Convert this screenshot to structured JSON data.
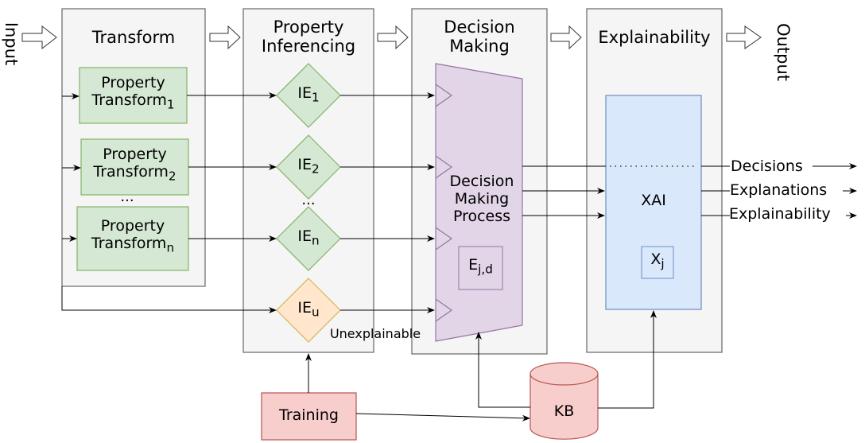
{
  "io": {
    "input_label": "Input",
    "output_label": "Output"
  },
  "stages": {
    "transform": {
      "title": "Transform"
    },
    "property_inferencing": {
      "title_line1": "Property",
      "title_line2": "Inferencing"
    },
    "decision_making": {
      "title_line1": "Decision",
      "title_line2": "Making"
    },
    "explainability": {
      "title": "Explainability"
    }
  },
  "transforms": [
    {
      "line1": "Property",
      "line2": "Transform",
      "sub": "1"
    },
    {
      "line1": "Property",
      "line2": "Transform",
      "sub": "2"
    },
    {
      "line1": "Property",
      "line2": "Transform",
      "sub": "n"
    }
  ],
  "transform_ellipsis": "...",
  "inference_engines": [
    {
      "label": "IE",
      "sub": "1",
      "type": "explainable"
    },
    {
      "label": "IE",
      "sub": "2",
      "type": "explainable"
    },
    {
      "label": "IE",
      "sub": "n",
      "type": "explainable"
    },
    {
      "label": "IE",
      "sub": "u",
      "type": "unexplainable"
    }
  ],
  "ie_ellipsis": "...",
  "unexplainable_label": "Unexplainable",
  "decision_process": {
    "line1": "Decision",
    "line2": "Making",
    "line3": "Process",
    "e_label": "E",
    "e_sub": "j,d"
  },
  "xai": {
    "label": "XAI",
    "x_label": "X",
    "x_sub": "j"
  },
  "outputs": [
    "Decisions",
    "Explanations",
    "Explainability"
  ],
  "training_label": "Training",
  "kb_label": "KB",
  "colors": {
    "stage_fill": "#f5f5f5",
    "stage_stroke": "#666666",
    "transform_fill": "#d5e8d4",
    "transform_stroke": "#82b366",
    "unexplainable_fill": "#ffe6cc",
    "unexplainable_stroke": "#d6b656",
    "decision_fill": "#e1d5e7",
    "decision_stroke": "#9673a6",
    "xai_fill": "#dae8fc",
    "xai_stroke": "#6c8ebf",
    "training_fill": "#f8cecc",
    "training_stroke": "#b85450"
  }
}
